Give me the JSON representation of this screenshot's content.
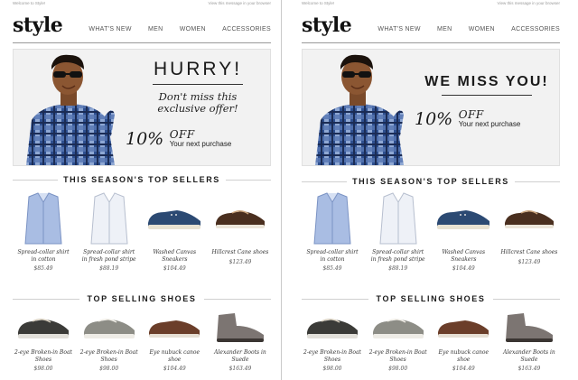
{
  "panels": [
    {
      "top_left": "Welcome to Style!",
      "top_right": "View this message in your browser",
      "logo": "style",
      "nav": [
        "WHAT'S NEW",
        "MEN",
        "WOMEN",
        "ACCESSORIES"
      ],
      "hero": {
        "headline": "HURRY!",
        "sub_line1": "Don't miss this",
        "sub_line2": "exclusive offer!",
        "offer_pct": "10%",
        "offer_off": "OFF",
        "offer_text": "Your next purchase"
      },
      "section1_title": "THIS SEASON'S TOP SELLERS",
      "top_sellers": [
        {
          "line1": "Spread-collar shirt",
          "line2": "in cotton",
          "price": "$85.49"
        },
        {
          "line1": "Spread-collar shirt",
          "line2": "in fresh pond stripe",
          "price": "$88.19"
        },
        {
          "line1": "Washed Canvas",
          "line2": "Sneakers",
          "price": "$104.49"
        },
        {
          "line1": "Hillcrest Cane shoes",
          "line2": "",
          "price": "$123.49"
        }
      ],
      "section2_title": "TOP SELLING SHOES",
      "top_shoes": [
        {
          "line1": "2-eye Broken-in Boat",
          "line2": "Shoes",
          "price": "$98.00"
        },
        {
          "line1": "2-eye Broken-in Boat",
          "line2": "Shoes",
          "price": "$98.00"
        },
        {
          "line1": "Eye nubuck canoe shoe",
          "line2": "",
          "price": "$104.49"
        },
        {
          "line1": "Alexander Boots in",
          "line2": "Suede",
          "price": "$163.49"
        }
      ]
    },
    {
      "top_left": "Welcome to Style!",
      "top_right": "View this message in your browser",
      "logo": "style",
      "nav": [
        "WHAT'S NEW",
        "MEN",
        "WOMEN",
        "ACCESSORIES"
      ],
      "hero": {
        "headline": "WE MISS YOU!",
        "offer_pct": "10%",
        "offer_off": "OFF",
        "offer_text": "Your next purchase"
      },
      "section1_title": "THIS SEASON'S TOP SELLERS",
      "top_sellers": [
        {
          "line1": "Spread-collar shirt",
          "line2": "in cotton",
          "price": "$85.49"
        },
        {
          "line1": "Spread-collar shirt",
          "line2": "in fresh pond stripe",
          "price": "$88.19"
        },
        {
          "line1": "Washed Canvas",
          "line2": "Sneakers",
          "price": "$104.49"
        },
        {
          "line1": "Hillcrest Cane shoes",
          "line2": "",
          "price": "$123.49"
        }
      ],
      "section2_title": "TOP SELLING SHOES",
      "top_shoes": [
        {
          "line1": "2-eye Broken-in Boat",
          "line2": "Shoes",
          "price": "$98.00"
        },
        {
          "line1": "2-eye Broken-in Boat",
          "line2": "Shoes",
          "price": "$98.00"
        },
        {
          "line1": "Eye nubuck canoe shoe",
          "line2": "",
          "price": "$104.49"
        },
        {
          "line1": "Alexander Boots in",
          "line2": "Suede",
          "price": "$163.49"
        }
      ]
    }
  ],
  "product_icons": {
    "top_sellers": [
      "blue-check-shirt-icon",
      "white-stripe-shirt-icon",
      "navy-canvas-sneaker-icon",
      "brown-boat-shoe-icon"
    ],
    "top_shoes": [
      "dark-boat-shoe-icon",
      "grey-boat-shoe-icon",
      "brown-canoe-shoe-icon",
      "grey-suede-boot-icon"
    ]
  }
}
